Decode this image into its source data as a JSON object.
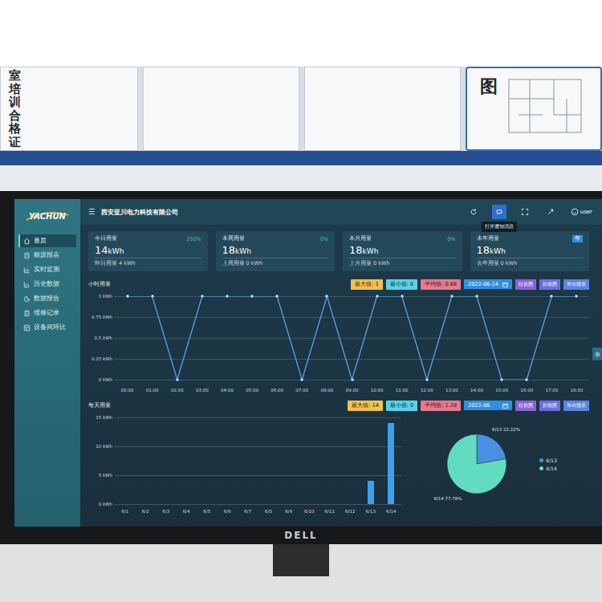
{
  "wall": {
    "certificate_text": "室培训合格证",
    "plan_title": "图"
  },
  "monitor": {
    "brand": "DELL"
  },
  "app": {
    "logo": "YACHUN",
    "menu_icon": "☰",
    "company": "西安亚川电力科技有限公司",
    "toolbar": [
      {
        "highlighted": false
      },
      {
        "highlighted": true
      },
      {
        "highlighted": false
      },
      {
        "highlighted": false
      }
    ],
    "tooltip": "打开通知消息",
    "user": "user"
  },
  "sidebar": {
    "items": [
      {
        "label": "首页",
        "selected": true
      },
      {
        "label": "能源报表",
        "selected": false
      },
      {
        "label": "实时监测",
        "selected": false
      },
      {
        "label": "历史数据",
        "selected": false
      },
      {
        "label": "数据报告",
        "selected": false
      },
      {
        "label": "维修记录",
        "selected": false
      },
      {
        "label": "设备间环比",
        "selected": false
      }
    ]
  },
  "cards": [
    {
      "title": "今日用量",
      "value": "14",
      "unit": "kWh",
      "kind": "percent",
      "change": "250%",
      "previous": "昨日用量 4 kWh"
    },
    {
      "title": "本周用量",
      "value": "18",
      "unit": "kWh",
      "kind": "percent",
      "change": "0%",
      "previous": "上周用量 0 kWh"
    },
    {
      "title": "本月用量",
      "value": "18",
      "unit": "kWh",
      "kind": "percent",
      "change": "0%",
      "previous": "上月用量 0 kWh"
    },
    {
      "title": "本年用量",
      "value": "18",
      "unit": "kWh",
      "kind": "badge",
      "change": "年",
      "previous": "去年用量 0 kWh"
    }
  ],
  "hourly_chart": {
    "title": "小时用量",
    "stats": [
      {
        "label": "最大值: 1",
        "color": "#f2c14e"
      },
      {
        "label": "最小值: 0",
        "color": "#56d3ea"
      },
      {
        "label": "平均值: 0.68",
        "color": "#e8788e"
      }
    ],
    "date": "2022-06-14",
    "buttons": [
      {
        "label": "柱状图",
        "color": "#8b63d9"
      },
      {
        "label": "折线图",
        "color": "#6b6fe0"
      },
      {
        "label": "导出报表",
        "color": "#5a86e0"
      }
    ],
    "y_ticks": [
      "1 kWh",
      "0.75 kWh",
      "0.5 kWh",
      "0.25 kWh",
      "0 kWh"
    ],
    "x_labels": [
      "00:00",
      "01:00",
      "02:00",
      "03:00",
      "04:00",
      "05:00",
      "06:00",
      "07:00",
      "08:00",
      "09:00",
      "10:00",
      "11:00",
      "12:00",
      "13:00",
      "14:00",
      "15:00",
      "16:00",
      "17:00",
      "18:00"
    ],
    "series": [
      {
        "values": [
          1,
          1,
          0,
          1,
          1,
          1,
          1,
          0,
          1,
          0,
          1,
          1,
          0,
          1,
          1,
          0,
          0,
          1,
          1
        ]
      }
    ]
  },
  "daily_chart": {
    "title": "每天用量",
    "stats": [
      {
        "label": "最大值: 14",
        "color": "#f2c14e"
      },
      {
        "label": "最小值: 0",
        "color": "#56d3ea"
      },
      {
        "label": "平均值: 1.29",
        "color": "#e8788e"
      }
    ],
    "date": "2022-06",
    "buttons": [
      {
        "label": "柱状图",
        "color": "#8b63d9"
      },
      {
        "label": "折线图",
        "color": "#6b6fe0"
      },
      {
        "label": "导出报表",
        "color": "#5a86e0"
      }
    ],
    "y_ticks": [
      "15 kWh",
      "10 kWh",
      "5 kWh",
      "0 kWh"
    ],
    "x_labels": [
      "6/1",
      "6/2",
      "6/3",
      "6/4",
      "6/5",
      "6/6",
      "6/7",
      "6/8",
      "6/9",
      "6/10",
      "6/11",
      "6/12",
      "6/13",
      "6/14"
    ],
    "series": [
      {
        "values": [
          0,
          0,
          0,
          0,
          0,
          0,
          0,
          0,
          0,
          0,
          0,
          0,
          4,
          14
        ]
      }
    ],
    "pie": {
      "slices": [
        {
          "label": "6/13",
          "text": "6/13 22.22%",
          "value": 4,
          "color": "#4a90e2"
        },
        {
          "label": "6/14",
          "text": "6/14 77.78%",
          "value": 14,
          "color": "#62dcc0"
        }
      ]
    }
  }
}
